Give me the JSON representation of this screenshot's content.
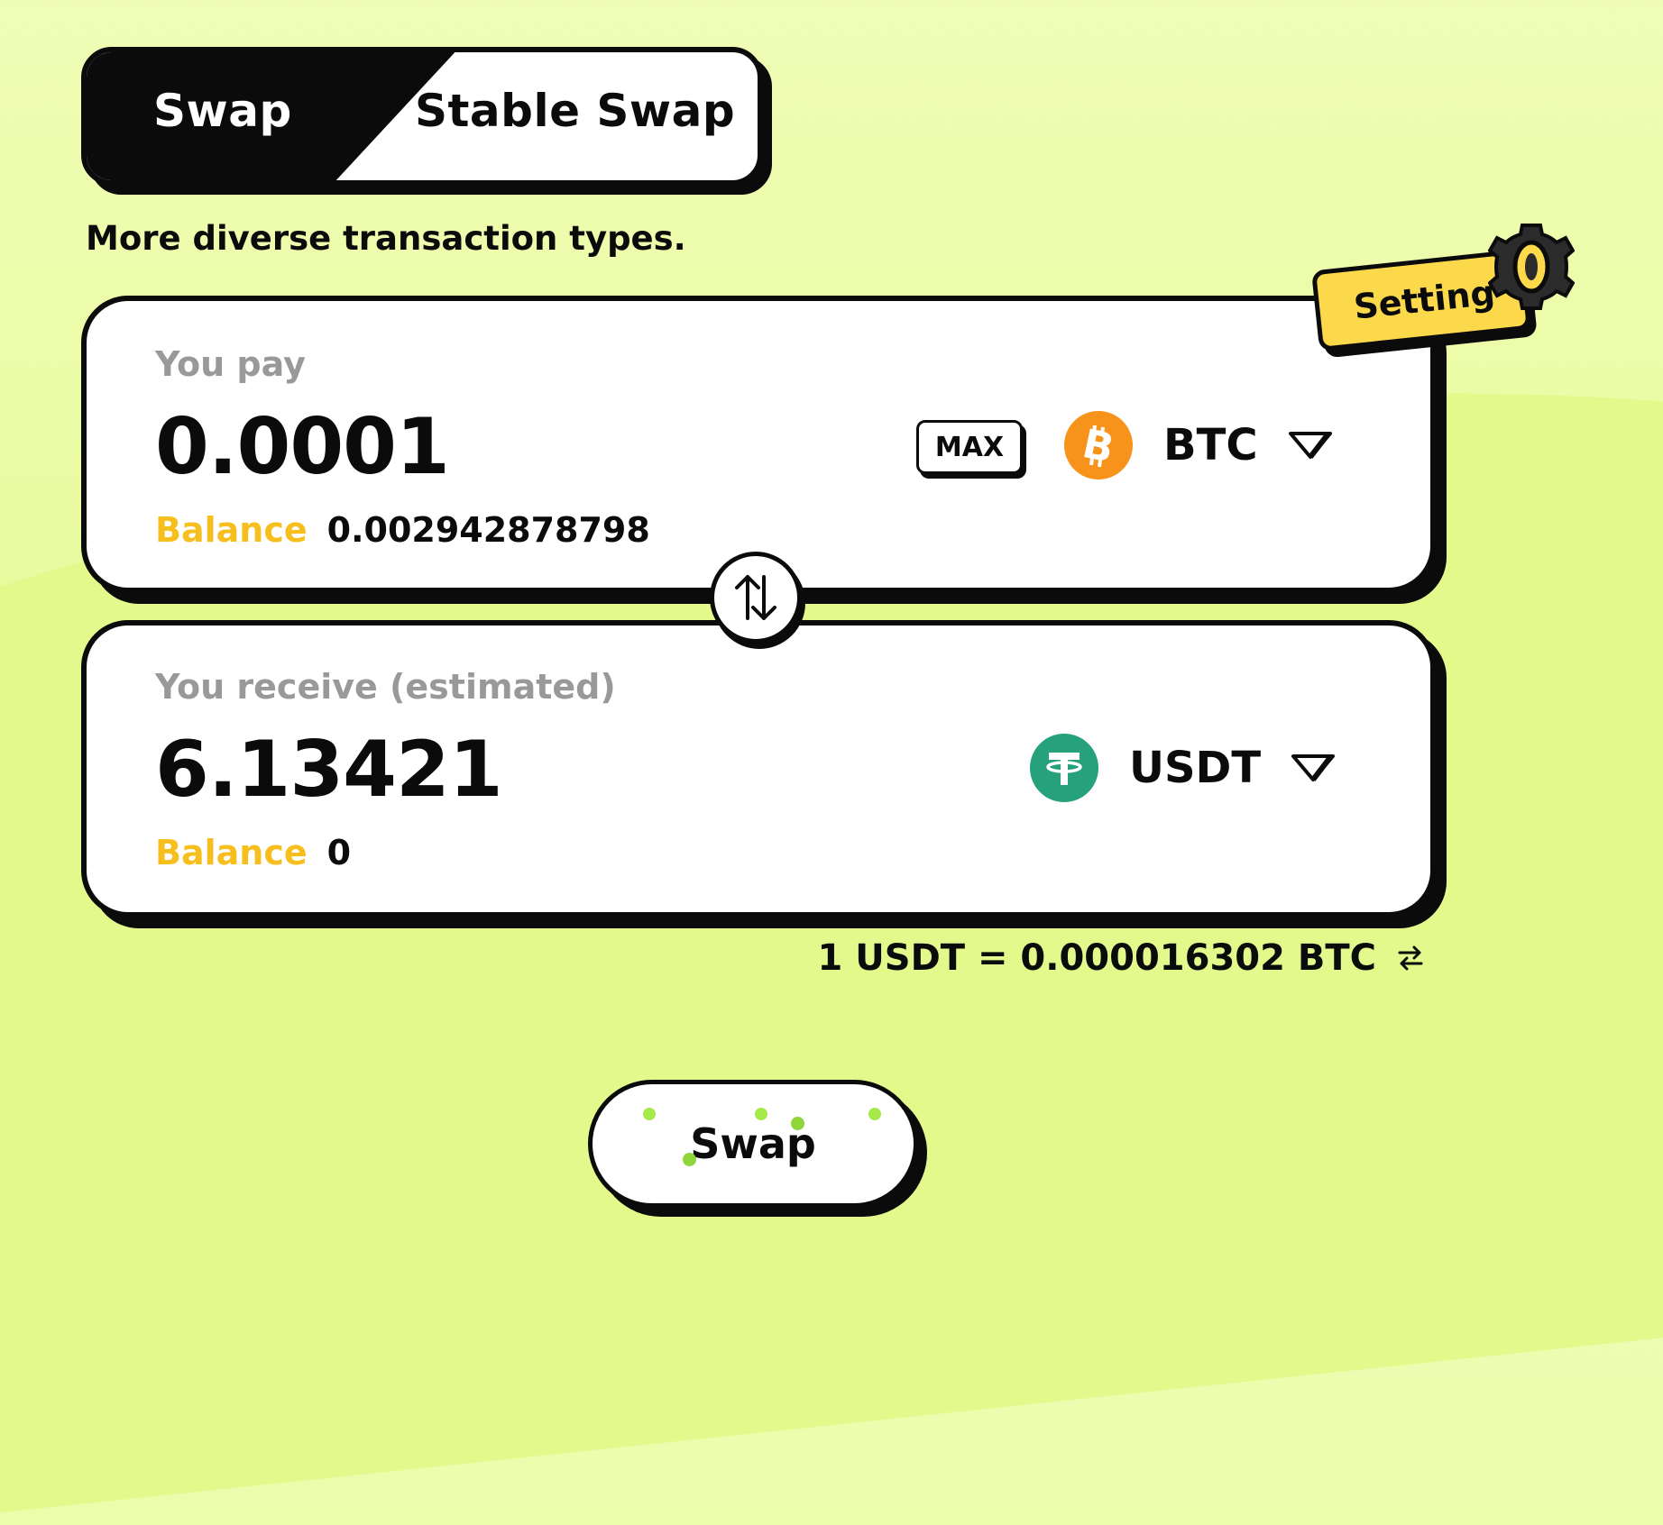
{
  "tabs": {
    "swap": "Swap",
    "stable_swap": "Stable Swap",
    "active": "swap"
  },
  "subtitle": "More diverse transaction types.",
  "setting_label": "Setting",
  "pay": {
    "label": "You pay",
    "amount": "0.0001",
    "max_label": "MAX",
    "token": "BTC",
    "token_icon": "bitcoin-icon",
    "balance_label": "Balance",
    "balance": "0.002942878798"
  },
  "receive": {
    "label": "You receive (estimated)",
    "amount": "6.13421",
    "token": "USDT",
    "token_icon": "tether-icon",
    "balance_label": "Balance",
    "balance": "0"
  },
  "rate": "1 USDT = 0.000016302 BTC",
  "swap_button": "Swap",
  "colors": {
    "accent_yellow": "#f7bf1e",
    "btc": "#f7931a",
    "usdt": "#26a17b",
    "setting_tag": "#fcd94a",
    "background": "#eaf99f"
  }
}
